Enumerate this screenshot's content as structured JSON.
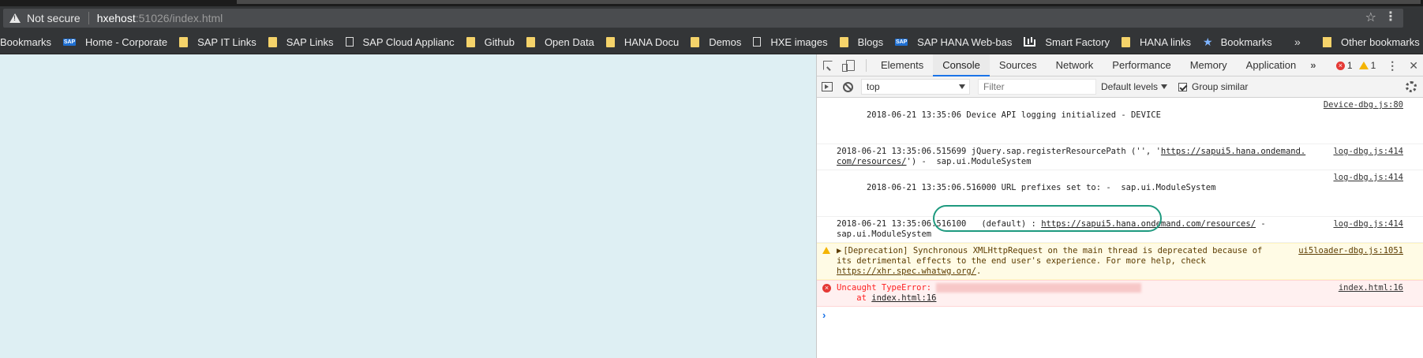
{
  "browser": {
    "address": {
      "security_label": "Not secure",
      "host": "hxehost",
      "path": ":51026/index.html"
    },
    "bookmarks": [
      {
        "label": "Bookmarks",
        "icon": "none"
      },
      {
        "label": "Home - Corporate",
        "icon": "sap-logo-icon"
      },
      {
        "label": "SAP IT Links",
        "icon": "folder-icon"
      },
      {
        "label": "SAP Links",
        "icon": "folder-icon"
      },
      {
        "label": "SAP Cloud Applianc",
        "icon": "page-icon"
      },
      {
        "label": "Github",
        "icon": "folder-icon"
      },
      {
        "label": "Open Data",
        "icon": "folder-icon"
      },
      {
        "label": "HANA Docu",
        "icon": "folder-icon"
      },
      {
        "label": "Demos",
        "icon": "folder-icon"
      },
      {
        "label": "HXE images",
        "icon": "page-icon"
      },
      {
        "label": "Blogs",
        "icon": "folder-icon"
      },
      {
        "label": "SAP HANA Web-bas",
        "icon": "sap-logo-icon"
      },
      {
        "label": "Smart Factory",
        "icon": "chart-icon"
      },
      {
        "label": "HANA links",
        "icon": "folder-icon"
      },
      {
        "label": "Bookmarks",
        "icon": "star-icon"
      }
    ],
    "overflow_label": "»",
    "other_bookmarks": "Other bookmarks"
  },
  "devtools": {
    "tabs": [
      "Elements",
      "Console",
      "Sources",
      "Network",
      "Performance",
      "Memory",
      "Application"
    ],
    "active_tab": "Console",
    "more_tabs": "»",
    "error_count": "1",
    "warning_count": "1",
    "toolbar": {
      "context": "top",
      "filter_placeholder": "Filter",
      "levels": "Default levels",
      "group_similar": "Group similar"
    },
    "messages": [
      {
        "level": "info",
        "text": "2018-06-21 13:35:06 Device API logging initialized - DEVICE",
        "source": "Device-dbg.js:80"
      },
      {
        "level": "info",
        "text_a": "2018-06-21 13:35:06.515699 jQuery.sap.registerResourcePath ('', '",
        "link_a": "https://sapui5.hana.ondemand.",
        "link_b": "com/resources/",
        "text_b": "') -  sap.ui.ModuleSystem",
        "source": "log-dbg.js:414"
      },
      {
        "level": "info",
        "text": "2018-06-21 13:35:06.516000 URL prefixes set to: -  sap.ui.ModuleSystem",
        "source": "log-dbg.js:414"
      },
      {
        "level": "info",
        "text_a": "2018-06-21 13:35:06.516100   (default) : ",
        "link": "https://sapui5.hana.ondemand.com/resources/",
        "text_b": " -",
        "text_c": "sap.ui.ModuleSystem",
        "source": "log-dbg.js:414"
      },
      {
        "level": "warning",
        "expander": "▶",
        "text_a": "[Deprecation] Synchronous XMLHttpRequest on the main thread is deprecated because of",
        "text_b": "its detrimental effects to the end user's experience. For more help, check ",
        "link": "https://xhr.spec.whatwg.org/",
        "text_c": ".",
        "source": "ui5loader-dbg.js:1051"
      },
      {
        "level": "error",
        "text": "Uncaught TypeError:",
        "stack_prefix": "    at ",
        "stack_link": "index.html:16",
        "source": "index.html:16"
      }
    ],
    "prompt": "›"
  }
}
